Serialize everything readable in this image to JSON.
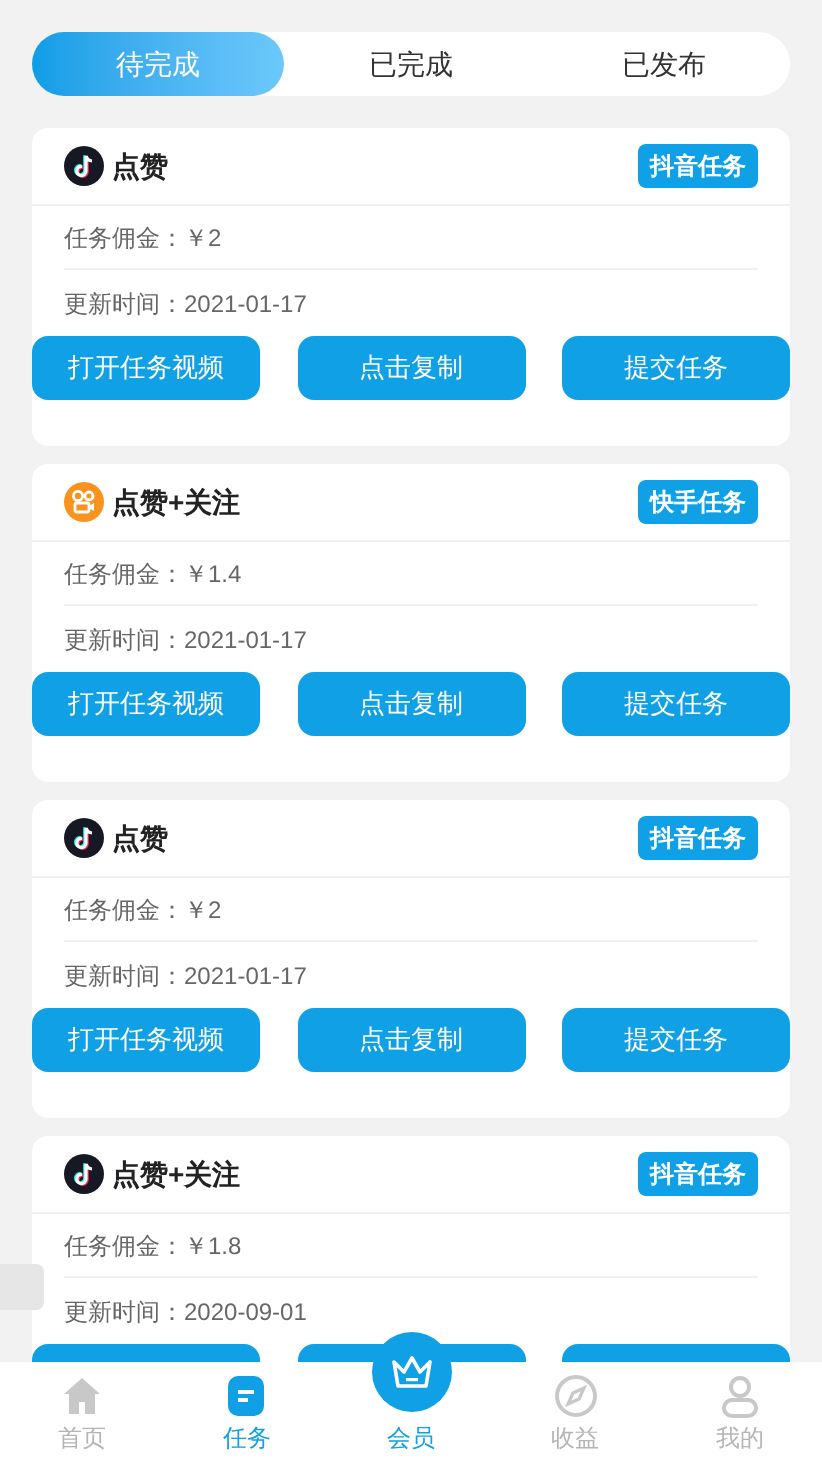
{
  "tabs": [
    {
      "label": "待完成",
      "selected": true
    },
    {
      "label": "已完成",
      "selected": false
    },
    {
      "label": "已发布",
      "selected": false
    }
  ],
  "tasks": [
    {
      "kind": "douyin",
      "title": "点赞",
      "tag": "抖音任务",
      "commission": "任务佣金：￥2",
      "updated": "更新时间：2021-01-17",
      "buttons": [
        "打开任务视频",
        "点击复制",
        "提交任务"
      ]
    },
    {
      "kind": "kuaishou",
      "title": "点赞+关注",
      "tag": "快手任务",
      "commission": "任务佣金：￥1.4",
      "updated": "更新时间：2021-01-17",
      "buttons": [
        "打开任务视频",
        "点击复制",
        "提交任务"
      ]
    },
    {
      "kind": "douyin",
      "title": "点赞",
      "tag": "抖音任务",
      "commission": "任务佣金：￥2",
      "updated": "更新时间：2021-01-17",
      "buttons": [
        "打开任务视频",
        "点击复制",
        "提交任务"
      ]
    },
    {
      "kind": "douyin",
      "title": "点赞+关注",
      "tag": "抖音任务",
      "commission": "任务佣金：￥1.8",
      "updated": "更新时间：2020-09-01"
    }
  ],
  "nav": [
    {
      "kind": "home",
      "label": "首页",
      "selected": false
    },
    {
      "kind": "task",
      "label": "任务",
      "selected": true
    },
    {
      "kind": "member",
      "label": "会员",
      "highlighted": true
    },
    {
      "kind": "income",
      "label": "收益",
      "selected": false
    },
    {
      "kind": "me",
      "label": "我的",
      "selected": false
    }
  ]
}
